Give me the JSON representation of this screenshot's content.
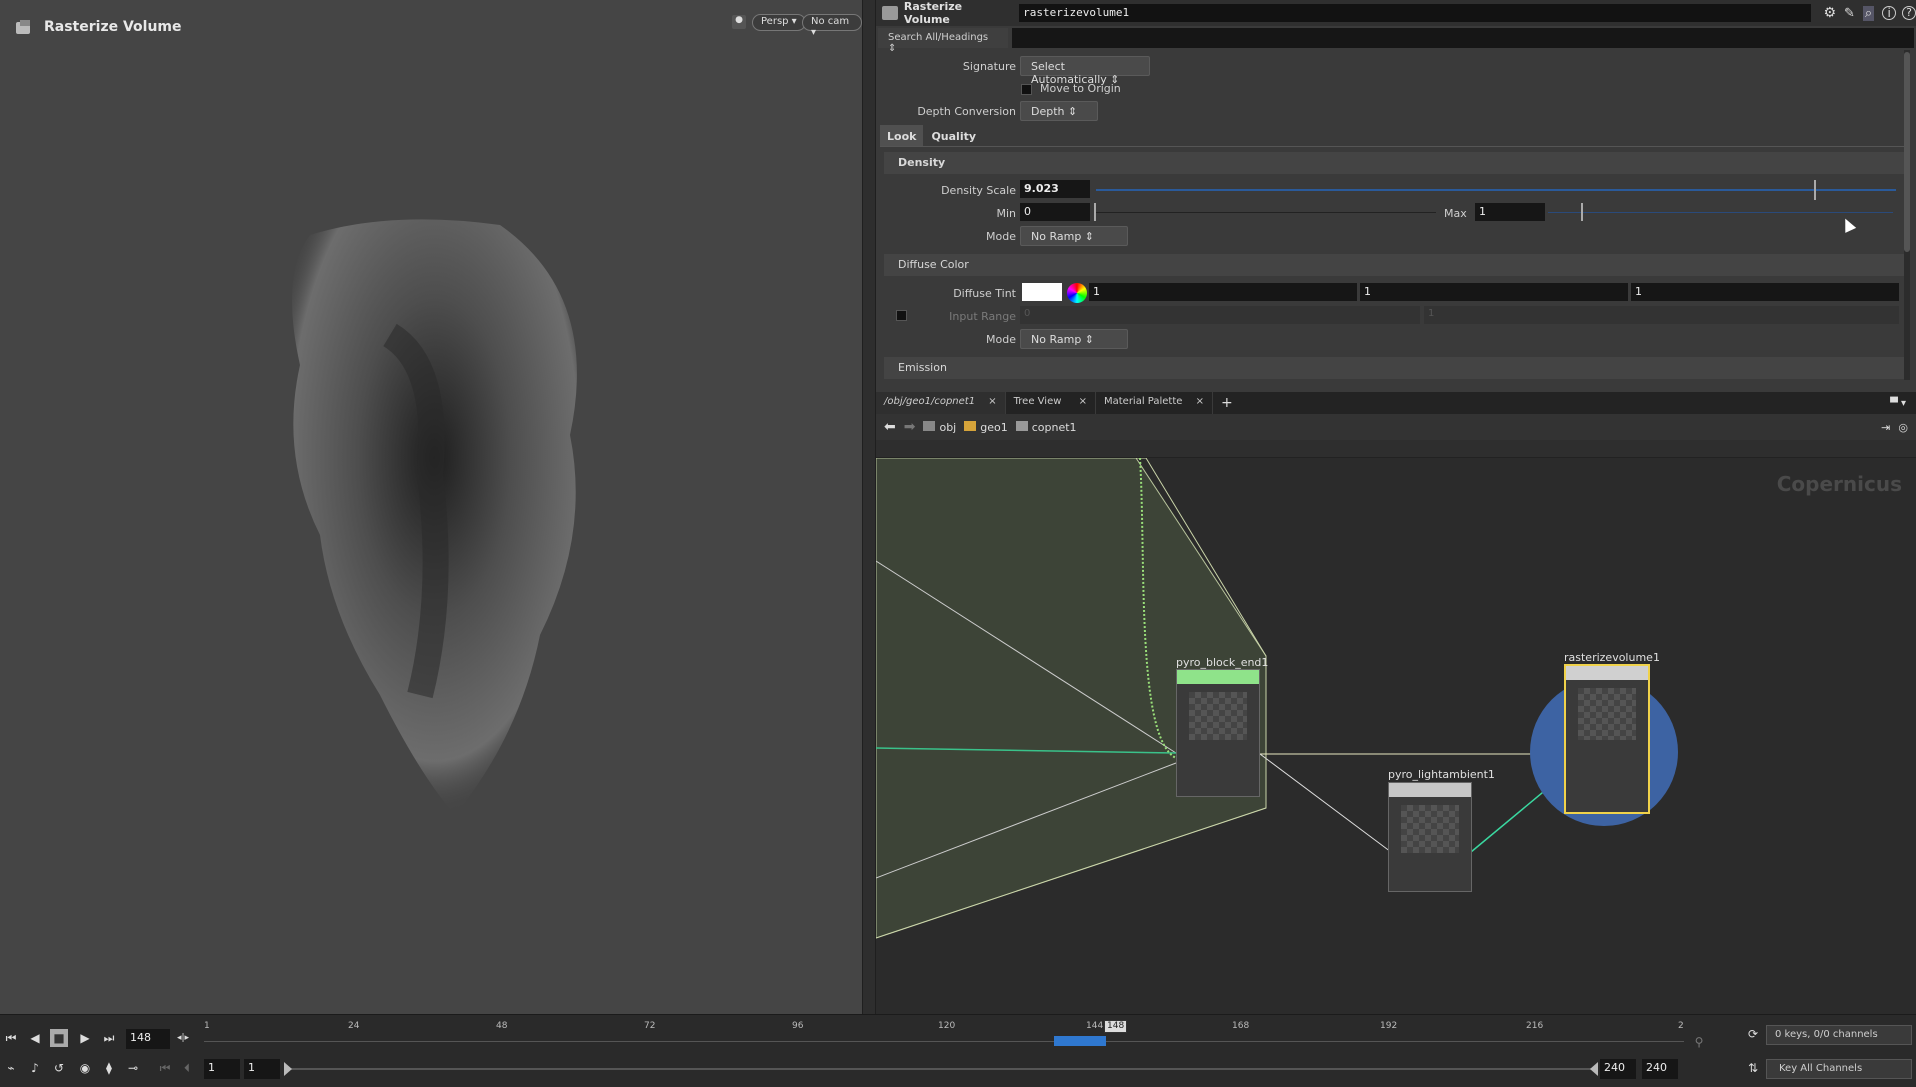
{
  "viewport": {
    "title": "Rasterize Volume",
    "persp_label": "Persp",
    "cam_label": "No cam"
  },
  "params": {
    "node_type": "Rasterize Volume",
    "node_name": "rasterizevolume1",
    "search_label": "Search All/Headings",
    "signature_label": "Signature",
    "signature_value": "Select Automatically",
    "move_to_origin_label": "Move to Origin",
    "depth_conversion_label": "Depth Conversion",
    "depth_conversion_value": "Depth",
    "tabs": [
      "Look",
      "Quality"
    ],
    "density_section": "Density",
    "density_scale_label": "Density Scale",
    "density_scale_value": "9.023",
    "min_label": "Min",
    "min_value": "0",
    "max_label": "Max",
    "max_value": "1",
    "mode_label": "Mode",
    "mode_value": "No Ramp",
    "diffuse_section": "Diffuse Color",
    "diffuse_tint_label": "Diffuse Tint",
    "diffuse_tint_values": [
      "1",
      "1",
      "1"
    ],
    "input_range_label": "Input Range",
    "input_range_values": [
      "0",
      "1"
    ],
    "mode2_label": "Mode",
    "mode2_value": "No Ramp",
    "emission_section": "Emission"
  },
  "network": {
    "tabs": [
      "/obj/geo1/copnet1",
      "Tree View",
      "Material Palette"
    ],
    "path": [
      "obj",
      "geo1",
      "copnet1"
    ],
    "context_label": "Copernicus",
    "nodes": {
      "pyro_block_end": "pyro_block_end1",
      "lightambient": "pyro_lightambient1",
      "rasterize": "rasterizevolume1"
    }
  },
  "timeline": {
    "current_frame": "148",
    "ticks": [
      "1",
      "24",
      "48",
      "72",
      "96",
      "120",
      "144",
      "168",
      "192",
      "216",
      "2"
    ],
    "range_start": "1",
    "range_start2": "1",
    "range_end": "240",
    "range_end2": "240",
    "keys_label": "0 keys, 0/0 channels",
    "key_all_label": "Key All Channels"
  }
}
